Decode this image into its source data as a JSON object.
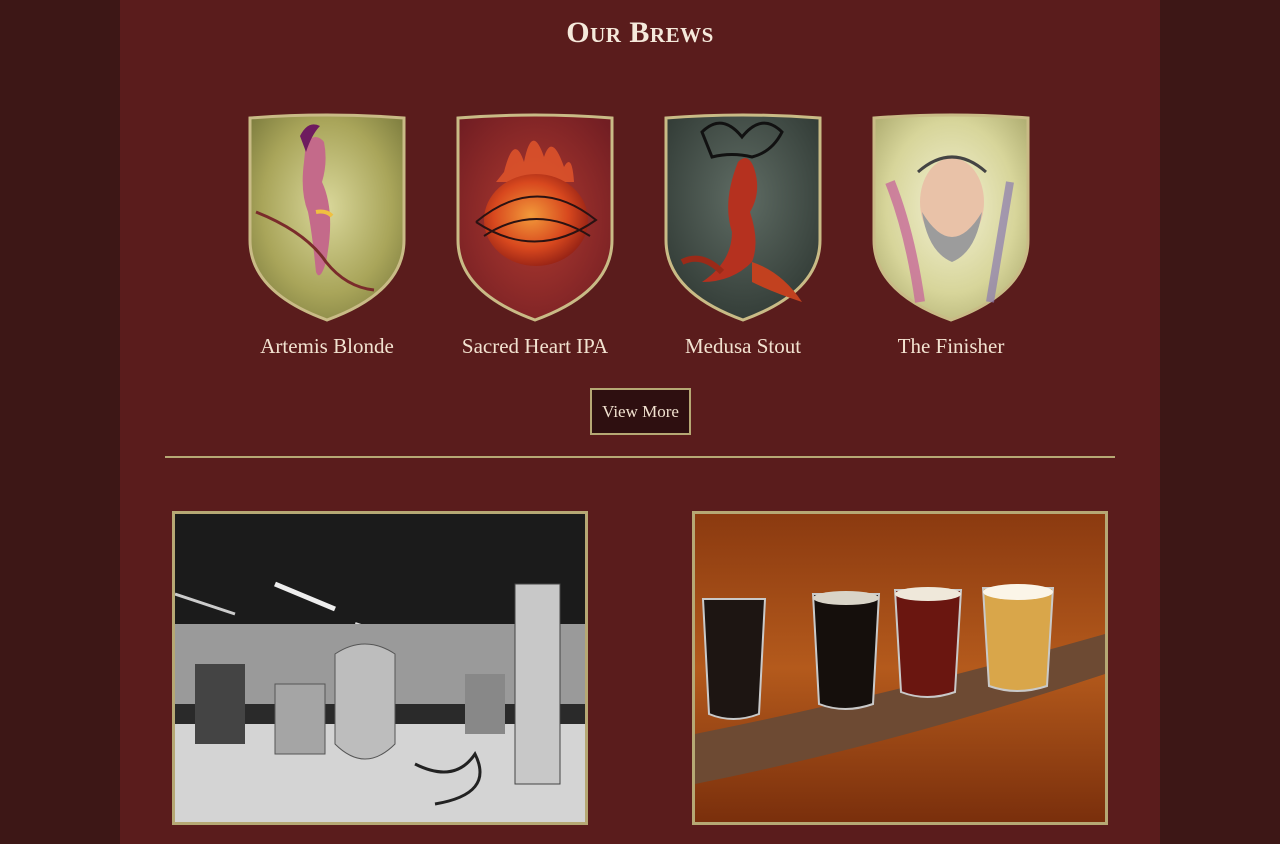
{
  "section": {
    "title": "Our Brews"
  },
  "brews": [
    {
      "name": "Artemis Blonde",
      "image": "artemis-shield-icon"
    },
    {
      "name": "Sacred Heart IPA",
      "image": "sacred-heart-shield-icon"
    },
    {
      "name": "Medusa Stout",
      "image": "medusa-shield-icon"
    },
    {
      "name": "The Finisher",
      "image": "finisher-shield-icon"
    }
  ],
  "view_more": {
    "label": "View More"
  },
  "photos": [
    {
      "subject": "brewery-interior-photo"
    },
    {
      "subject": "beer-flight-photo"
    }
  ],
  "colors": {
    "page_bg": "#5a1c1c",
    "outer_bg": "#3d1716",
    "gold_accent": "#b6a874",
    "text": "#f2e2d0"
  }
}
